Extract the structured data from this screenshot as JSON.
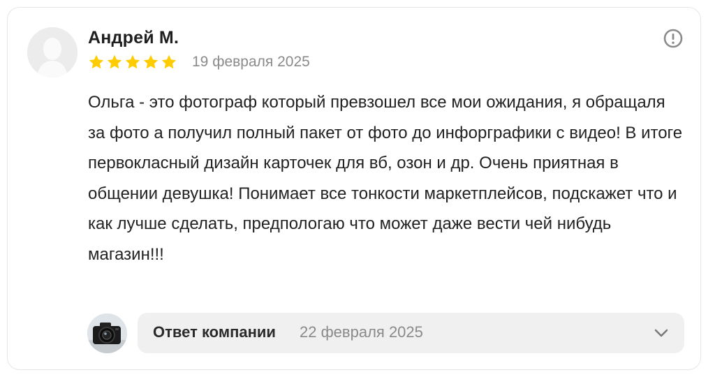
{
  "review": {
    "author": "Андрей М.",
    "rating": 5,
    "rating_max": 5,
    "date": "19 февраля 2025",
    "text": "Ольга - это фотограф который превзошел все мои ожидания, я обращаля за фото а получил полный пакет от фото до инфорграфики с видео! В итоге первокласный дизайн карточек для вб, озон и др. Очень приятная в общении девушка! Понимает все тонкости маркетплейсов, подскажет что и как лучше сделать, предпологаю что может даже вести чей нибудь магазин!!!",
    "report_icon": "exclamation-circle-icon"
  },
  "company_reply": {
    "label": "Ответ компании",
    "date": "22 февраля 2025",
    "avatar_icon": "camera-photo-avatar",
    "expand_icon": "chevron-down-icon"
  },
  "colors": {
    "star": "#ffcc00",
    "muted_text": "#8a8a8a",
    "reply_bg": "#f0f0f0",
    "border": "#e6e6e6"
  }
}
